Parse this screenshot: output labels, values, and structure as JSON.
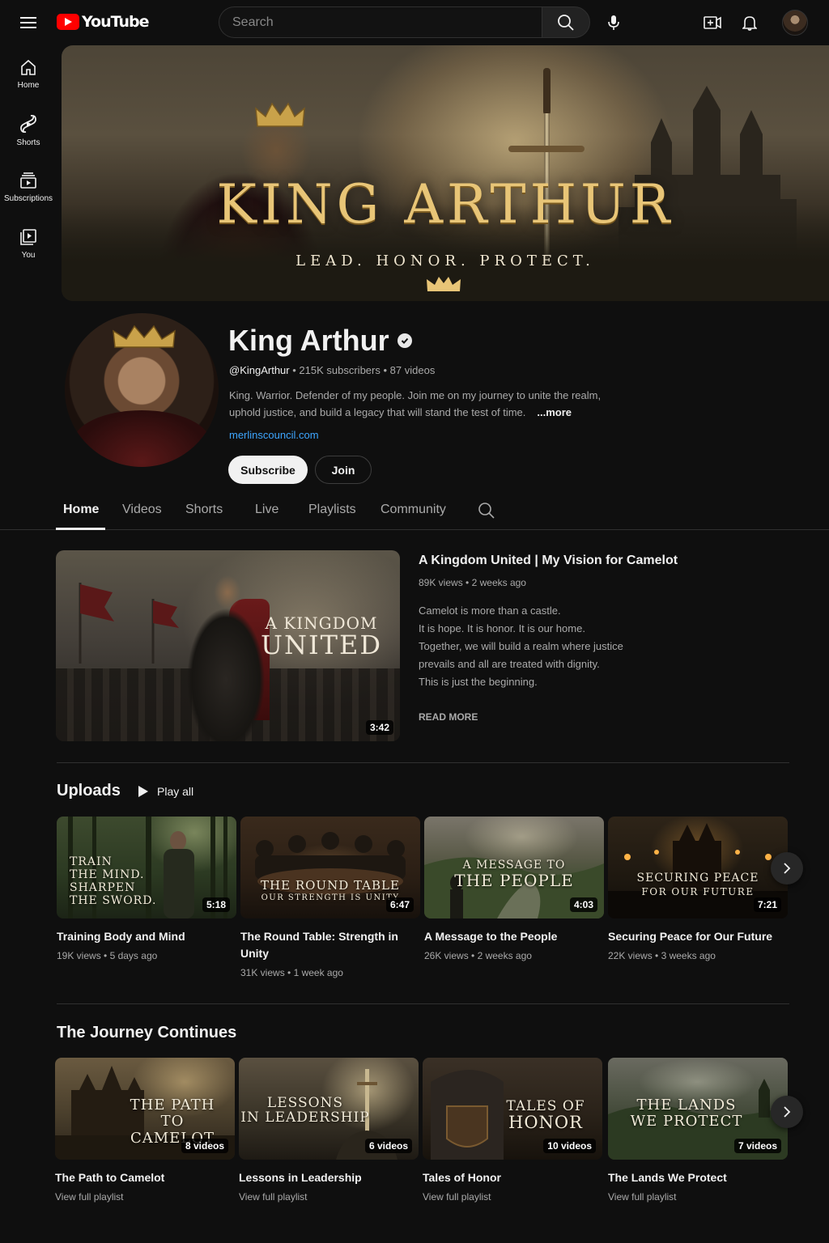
{
  "topbar": {
    "logo_text": "YouTube",
    "search_placeholder": "Search",
    "icons": [
      "menu-icon",
      "search-icon",
      "mic-icon",
      "create-icon",
      "bell-icon"
    ]
  },
  "sidenav": {
    "items": [
      {
        "label": "Home",
        "icon": "home-icon"
      },
      {
        "label": "Shorts",
        "icon": "shorts-icon"
      },
      {
        "label": "Subscriptions",
        "icon": "subscriptions-icon"
      },
      {
        "label": "You",
        "icon": "you-icon"
      }
    ]
  },
  "banner": {
    "title": "KING ARTHUR",
    "subtitle": "LEAD. HONOR. PROTECT."
  },
  "channel": {
    "name": "King Arthur",
    "handle": "@KingArthur",
    "subscribers": "215K subscribers",
    "videos": "87 videos",
    "description": "King. Warrior. Defender of my people. Join me on my journey to unite the realm, uphold justice, and build a legacy that will stand the test of time.",
    "more_label": "...more",
    "link": "merlinscouncil.com",
    "subscribe_label": "Subscribe",
    "join_label": "Join"
  },
  "tabs": {
    "home": "Home",
    "videos": "Videos",
    "shorts": "Shorts",
    "live": "Live",
    "playlists": "Playlists",
    "community": "Community",
    "active": "Home"
  },
  "featured": {
    "thumb_line1": "A KINGDOM",
    "thumb_line2": "UNITED",
    "duration": "3:42",
    "title": "A Kingdom United | My Vision for Camelot",
    "views": "89K views",
    "age": "2 weeks ago",
    "desc_lines": [
      "Camelot is more than a castle.",
      "It is hope. It is honor. It is our home.",
      "Together, we will build a realm where justice",
      "prevails and all are treated with dignity.",
      "This is just the beginning."
    ],
    "read_more": "READ MORE"
  },
  "uploads": {
    "title": "Uploads",
    "play_all": "Play all",
    "videos": [
      {
        "thumb_text": "TRAIN\nTHE MIND.\nSHARPEN\nTHE SWORD.",
        "duration": "5:18",
        "title": "Training Body and Mind",
        "views": "19K views",
        "age": "5 days ago"
      },
      {
        "thumb_text": "THE ROUND TABLE",
        "thumb_sub": "OUR STRENGTH IS UNITY",
        "duration": "6:47",
        "title": "The Round Table: Strength in Unity",
        "views": "31K views",
        "age": "1 week ago"
      },
      {
        "thumb_text": "A MESSAGE TO",
        "thumb_sub": "THE PEOPLE",
        "duration": "4:03",
        "title": "A Message to the People",
        "views": "26K views",
        "age": "2 weeks ago"
      },
      {
        "thumb_text": "SECURING PEACE",
        "thumb_sub": "FOR OUR FUTURE",
        "duration": "7:21",
        "title": "Securing Peace for Our Future",
        "views": "22K views",
        "age": "3 weeks ago"
      }
    ]
  },
  "journey": {
    "title": "The Journey Continues",
    "playlists": [
      {
        "thumb_line1": "THE PATH",
        "thumb_line2": "TO CAMELOT",
        "count": "8 videos",
        "title": "The Path to Camelot",
        "link": "View full playlist"
      },
      {
        "thumb_line1": "LESSONS",
        "thumb_line2": "IN LEADERSHIP",
        "count": "6 videos",
        "title": "Lessons in Leadership",
        "link": "View full playlist"
      },
      {
        "thumb_line1": "TALES OF",
        "thumb_line2": "HONOR",
        "count": "10 videos",
        "title": "Tales of Honor",
        "link": "View full playlist"
      },
      {
        "thumb_line1": "THE LANDS",
        "thumb_line2": "WE PROTECT",
        "count": "7 videos",
        "title": "The Lands We Protect",
        "link": "View full playlist"
      }
    ]
  },
  "colors": {
    "background": "#0f0f0f",
    "text": "#f1f1f1",
    "secondary_text": "#aaaaaa",
    "link": "#3ea6ff",
    "youtube_red": "#ff0000",
    "banner_gold": "#e8c577"
  }
}
